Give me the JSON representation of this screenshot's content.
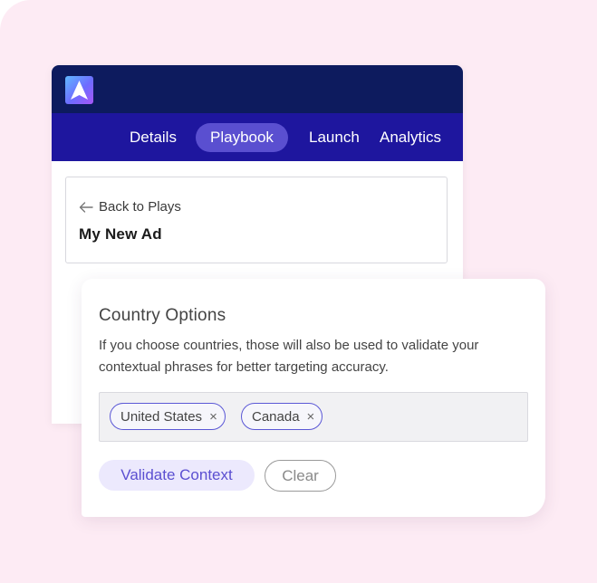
{
  "app": {
    "logo_icon": "brand-logo-icon"
  },
  "nav": {
    "tabs": [
      {
        "label": "Details",
        "active": false
      },
      {
        "label": "Playbook",
        "active": true
      },
      {
        "label": "Launch",
        "active": false
      },
      {
        "label": "Analytics",
        "active": false
      }
    ]
  },
  "breadcrumb": {
    "back_label": "Back to Plays",
    "back_icon": "arrow-left-icon",
    "title": "My New Ad"
  },
  "country_options": {
    "title": "Country Options",
    "description": "If you choose countries, those will also be used to validate your contextual phrases for better targeting accuracy.",
    "selected": [
      {
        "label": "United States",
        "remove_glyph": "×"
      },
      {
        "label": "Canada",
        "remove_glyph": "×"
      }
    ],
    "validate_label": "Validate Context",
    "clear_label": "Clear"
  },
  "colors": {
    "background": "#fdebf4",
    "topbar": "#0d1b5e",
    "navbar": "#1e169e",
    "active_tab": "#5a4fd0",
    "accent": "#5b4fd1"
  }
}
